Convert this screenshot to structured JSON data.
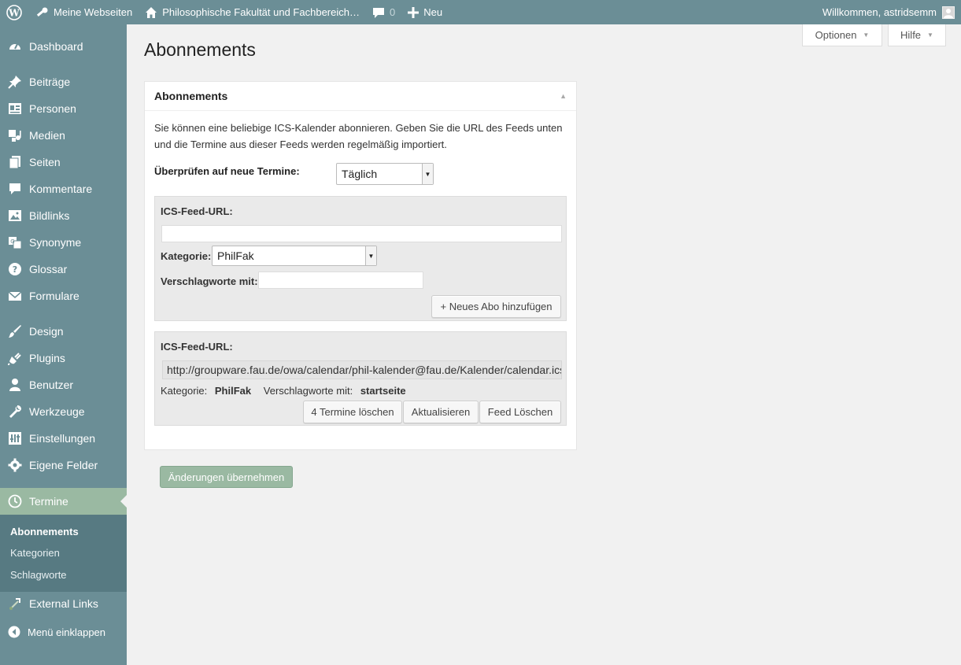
{
  "adminbar": {
    "my_sites": "Meine Webseiten",
    "site_name": "Philosophische Fakultät und Fachbereich…",
    "comments_count": "0",
    "new_label": "Neu",
    "welcome": "Willkommen, astridsemm"
  },
  "sidebar": {
    "items": [
      {
        "label": "Dashboard",
        "icon": "dashboard-icon"
      },
      {
        "label": "Beiträge",
        "icon": "pin-icon"
      },
      {
        "label": "Personen",
        "icon": "id-card-icon"
      },
      {
        "label": "Medien",
        "icon": "media-icon"
      },
      {
        "label": "Seiten",
        "icon": "pages-icon"
      },
      {
        "label": "Kommentare",
        "icon": "comment-icon"
      },
      {
        "label": "Bildlinks",
        "icon": "image-icon"
      },
      {
        "label": "Synonyme",
        "icon": "translate-icon"
      },
      {
        "label": "Glossar",
        "icon": "help-icon"
      },
      {
        "label": "Formulare",
        "icon": "envelope-icon"
      },
      {
        "label": "Design",
        "icon": "brush-icon"
      },
      {
        "label": "Plugins",
        "icon": "plug-icon"
      },
      {
        "label": "Benutzer",
        "icon": "user-icon"
      },
      {
        "label": "Werkzeuge",
        "icon": "wrench-icon"
      },
      {
        "label": "Einstellungen",
        "icon": "settings-icon"
      },
      {
        "label": "Eigene Felder",
        "icon": "gear-icon"
      },
      {
        "label": "Termine",
        "icon": "clock-icon"
      },
      {
        "label": "External Links",
        "icon": "external-link-icon"
      }
    ],
    "submenu": [
      "Abonnements",
      "Kategorien",
      "Schlagworte"
    ],
    "collapse": "Menü einklappen"
  },
  "screen_meta": {
    "options": "Optionen",
    "help": "Hilfe"
  },
  "page": {
    "title": "Abonnements"
  },
  "box": {
    "title": "Abonnements",
    "intro": "Sie können eine beliebige ICS-Kalender abonnieren. Geben Sie die URL des Feeds unten und die Termine aus dieser Feeds werden regelmäßig importiert.",
    "freq_label": "Überprüfen auf neue Termine:",
    "freq_value": "Täglich",
    "new_feed": {
      "url_label": "ICS-Feed-URL:",
      "url_value": "",
      "category_label": "Kategorie:",
      "category_value": "PhilFak",
      "tags_label": "Verschlagworte mit:",
      "tags_value": "",
      "add_button": "+ Neues Abo hinzufügen"
    },
    "existing_feed": {
      "url_label": "ICS-Feed-URL:",
      "url_value": "http://groupware.fau.de/owa/calendar/phil-kalender@fau.de/Kalender/calendar.ics",
      "category_label": "Kategorie:",
      "category_value": "PhilFak",
      "tags_label": "Verschlagworte mit:",
      "tags_value": "startseite",
      "delete_events_button": "4 Termine löschen",
      "refresh_button": "Aktualisieren",
      "delete_feed_button": "Feed Löschen"
    }
  },
  "submit_button": "Änderungen übernehmen",
  "colors": {
    "sidebar": "#6b8e96",
    "current": "#9ab9a2",
    "submenu": "#577a82"
  }
}
